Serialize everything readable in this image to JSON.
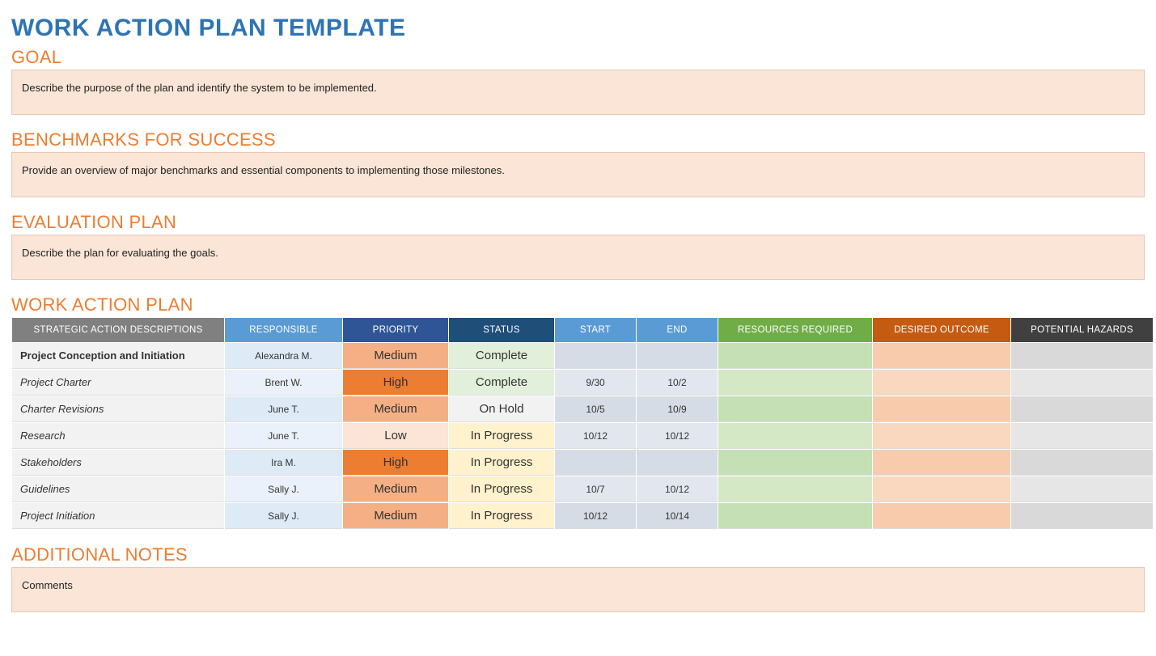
{
  "title": "WORK ACTION PLAN TEMPLATE",
  "sections": {
    "goal": {
      "heading": "GOAL",
      "text": "Describe the purpose of the plan and identify the system to be implemented."
    },
    "benchmarks": {
      "heading": "BENCHMARKS FOR SUCCESS",
      "text": "Provide an overview of major benchmarks and essential components to implementing those milestones."
    },
    "evaluation": {
      "heading": "EVALUATION PLAN",
      "text": "Describe the plan for evaluating the goals."
    },
    "plan": {
      "heading": "WORK ACTION PLAN"
    },
    "notes": {
      "heading": "ADDITIONAL NOTES",
      "text": "Comments"
    }
  },
  "table": {
    "headers": {
      "strategic": "STRATEGIC ACTION DESCRIPTIONS",
      "responsible": "RESPONSIBLE",
      "priority": "PRIORITY",
      "status": "STATUS",
      "start": "START",
      "end": "END",
      "resources": "RESOURCES REQUIRED",
      "outcome": "DESIRED OUTCOME",
      "hazards": "POTENTIAL HAZARDS"
    },
    "rows": [
      {
        "category": true,
        "desc": "Project Conception and Initiation",
        "responsible": "Alexandra M.",
        "priority": "Medium",
        "status": "Complete",
        "start": "",
        "end": "",
        "resources": "",
        "outcome": "",
        "hazards": ""
      },
      {
        "category": false,
        "desc": "Project Charter",
        "responsible": "Brent W.",
        "priority": "High",
        "status": "Complete",
        "start": "9/30",
        "end": "10/2",
        "resources": "",
        "outcome": "",
        "hazards": ""
      },
      {
        "category": false,
        "desc": "Charter Revisions",
        "responsible": "June T.",
        "priority": "Medium",
        "status": "On Hold",
        "start": "10/5",
        "end": "10/9",
        "resources": "",
        "outcome": "",
        "hazards": ""
      },
      {
        "category": false,
        "desc": "Research",
        "responsible": "June T.",
        "priority": "Low",
        "status": "In Progress",
        "start": "10/12",
        "end": "10/12",
        "resources": "",
        "outcome": "",
        "hazards": ""
      },
      {
        "category": false,
        "desc": "Stakeholders",
        "responsible": "Ira M.",
        "priority": "High",
        "status": "In Progress",
        "start": "",
        "end": "",
        "resources": "",
        "outcome": "",
        "hazards": ""
      },
      {
        "category": false,
        "desc": "Guidelines",
        "responsible": "Sally J.",
        "priority": "Medium",
        "status": "In Progress",
        "start": "10/7",
        "end": "10/12",
        "resources": "",
        "outcome": "",
        "hazards": ""
      },
      {
        "category": false,
        "desc": "Project Initiation",
        "responsible": "Sally J.",
        "priority": "Medium",
        "status": "In Progress",
        "start": "10/12",
        "end": "10/14",
        "resources": "",
        "outcome": "",
        "hazards": ""
      }
    ]
  },
  "style_maps": {
    "priority": {
      "High": "priority-high",
      "Medium": "priority-medium",
      "Low": "priority-low"
    },
    "status": {
      "Complete": "status-complete",
      "On Hold": "status-onhold",
      "In Progress": "status-inprogress"
    }
  }
}
